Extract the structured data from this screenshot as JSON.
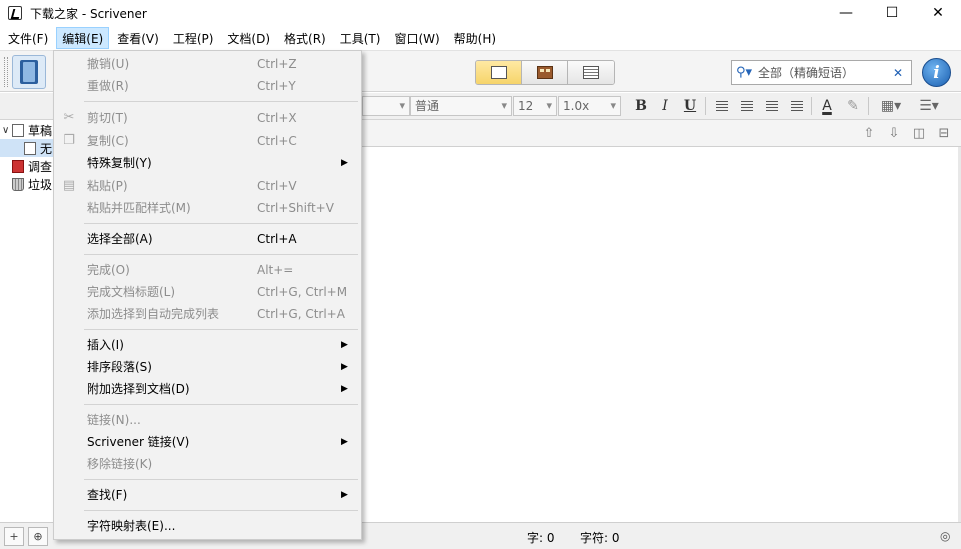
{
  "window": {
    "title": "下载之家 - Scrivener",
    "minimize_glyph": "—",
    "maximize_glyph": "☐",
    "close_glyph": "✕"
  },
  "menubar": [
    {
      "label": "文件(F)"
    },
    {
      "label": "编辑(E)"
    },
    {
      "label": "查看(V)"
    },
    {
      "label": "工程(P)"
    },
    {
      "label": "文档(D)"
    },
    {
      "label": "格式(R)"
    },
    {
      "label": "工具(T)"
    },
    {
      "label": "窗口(W)"
    },
    {
      "label": "帮助(H)"
    }
  ],
  "toolbar": {
    "search_placeholder": "全部（精确短语）",
    "search_icon": "⚲▾",
    "clear_icon": "✕",
    "info_label": "i"
  },
  "formatbar": {
    "style": "普通",
    "font_size": "12",
    "line_spacing": "1.0x",
    "bold": "B",
    "italic": "I",
    "underline": "U",
    "text_color_glyph": "A",
    "highlight_glyph": "✎",
    "table_glyph": "▦▾",
    "list_glyph": "☰▾"
  },
  "binder": {
    "items": [
      {
        "twist": "∨",
        "label": "草稿"
      },
      {
        "label": "无"
      },
      {
        "label": "调查"
      },
      {
        "label": "垃圾"
      }
    ]
  },
  "editor_header": {
    "up": "⇧",
    "down": "⇩",
    "split_v": "◫",
    "split_h": "⊟"
  },
  "statusbar": {
    "words": "字: 0",
    "chars": "字符: 0",
    "add_glyph": "+",
    "folder_glyph": "⊕",
    "target_glyph": "◎"
  },
  "edit_menu": {
    "items": [
      {
        "label": "撤销(U)",
        "shortcut": "Ctrl+Z",
        "disabled": true
      },
      {
        "label": "重做(R)",
        "shortcut": "Ctrl+Y",
        "disabled": true
      },
      {
        "label": "剪切(T)",
        "shortcut": "Ctrl+X",
        "disabled": true,
        "icon": "✂"
      },
      {
        "label": "复制(C)",
        "shortcut": "Ctrl+C",
        "disabled": true,
        "icon": "❐"
      },
      {
        "label": "特殊复制(Y)",
        "submenu": true
      },
      {
        "label": "粘贴(P)",
        "shortcut": "Ctrl+V",
        "disabled": true,
        "icon": "▤"
      },
      {
        "label": "粘贴并匹配样式(M)",
        "shortcut": "Ctrl+Shift+V",
        "disabled": true
      },
      {
        "label": "选择全部(A)",
        "shortcut": "Ctrl+A"
      },
      {
        "label": "完成(O)",
        "shortcut": "Alt+=",
        "disabled": true
      },
      {
        "label": "完成文档标题(L)",
        "shortcut": "Ctrl+G, Ctrl+M",
        "disabled": true
      },
      {
        "label": "添加选择到自动完成列表",
        "shortcut": "Ctrl+G, Ctrl+A",
        "disabled": true
      },
      {
        "label": "插入(I)",
        "submenu": true
      },
      {
        "label": "排序段落(S)",
        "submenu": true
      },
      {
        "label": "附加选择到文档(D)",
        "submenu": true
      },
      {
        "label": "链接(N)...",
        "disabled": true
      },
      {
        "label": "Scrivener 链接(V)",
        "submenu": true
      },
      {
        "label": "移除链接(K)",
        "disabled": true
      },
      {
        "label": "查找(F)",
        "submenu": true
      },
      {
        "label": "字符映射表(E)..."
      }
    ],
    "submenu_arrow": "▶"
  }
}
